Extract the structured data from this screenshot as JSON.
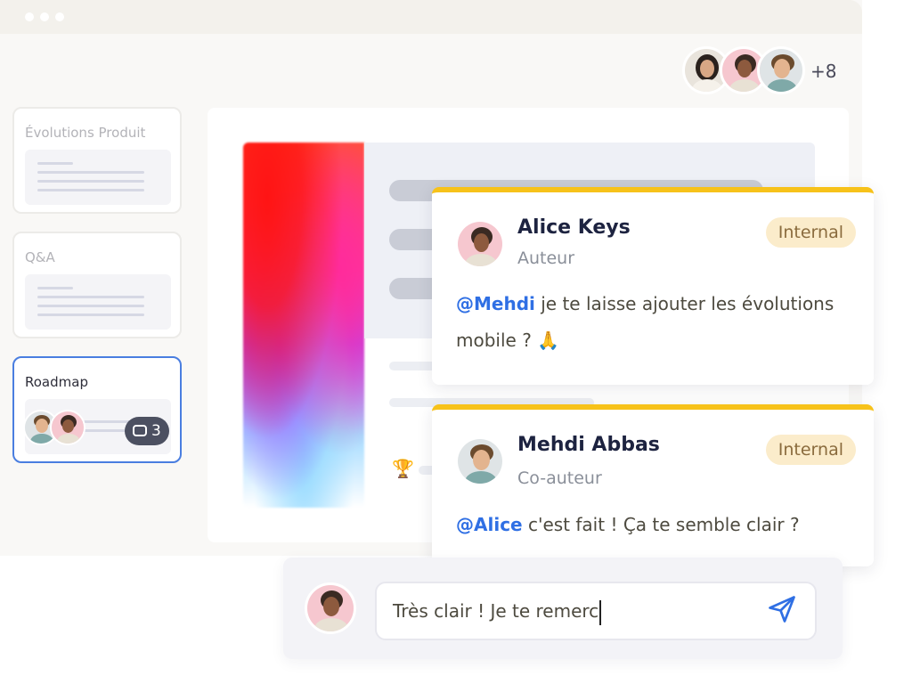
{
  "header": {
    "participants": [
      {
        "name": "woman-avatar"
      },
      {
        "name": "alice-avatar"
      },
      {
        "name": "mehdi-avatar"
      }
    ],
    "more_count": "+8"
  },
  "sidebar": {
    "items": [
      {
        "label": "Évolutions Produit"
      },
      {
        "label": "Q&A"
      },
      {
        "label": "Roadmap",
        "comment_count": "3"
      }
    ]
  },
  "comments": [
    {
      "author": "Alice Keys",
      "role": "Auteur",
      "tag": "Internal",
      "mention": "@Mehdi",
      "text_line1": " je te laisse ajouter les évolutions",
      "text_line2": "mobile ? 🙏"
    },
    {
      "author": "Mehdi Abbas",
      "role": "Co-auteur",
      "tag": "Internal",
      "mention": "@Alice",
      "text_line1": " c'est fait ! Ça te semble clair ?"
    }
  ],
  "reply": {
    "value": "Très clair ! Je te remerc"
  },
  "colors": {
    "accent_yellow": "#f7c21a",
    "mention_blue": "#2f6fe4",
    "active_border": "#4a7ee0",
    "tag_bg": "#fbeccb"
  }
}
